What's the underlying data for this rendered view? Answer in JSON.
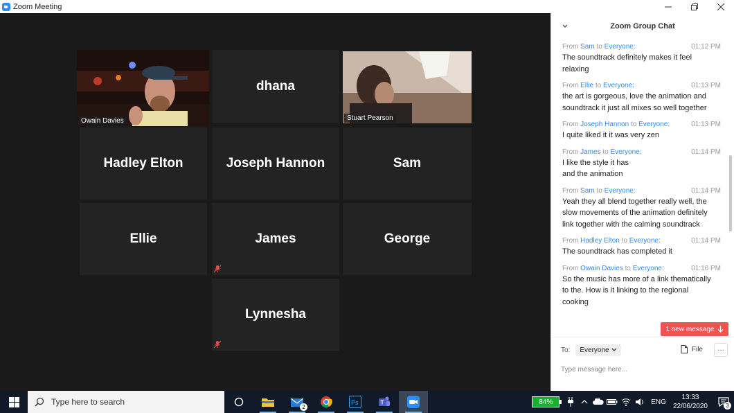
{
  "window": {
    "title": "Zoom Meeting"
  },
  "participants": [
    {
      "name": "Owain Davies",
      "video": true,
      "active": true
    },
    {
      "name": "dhana",
      "video": false
    },
    {
      "name": "Stuart Pearson",
      "video": true
    },
    {
      "name": "Hadley Elton",
      "video": false
    },
    {
      "name": "Joseph Hannon",
      "video": false
    },
    {
      "name": "Sam",
      "video": false
    },
    {
      "name": "Ellie",
      "video": false
    },
    {
      "name": "James",
      "video": false,
      "muted": true
    },
    {
      "name": "George",
      "video": false
    },
    {
      "name": "Lynnesha",
      "video": false,
      "muted": true
    }
  ],
  "chat": {
    "title": "Zoom Group Chat",
    "from_word": "From",
    "to_word": "to",
    "messages": [
      {
        "sender": "Sam",
        "recipient": "Everyone:",
        "time": "01:12 PM",
        "text": "The soundtrack definitely makes it feel relaxing"
      },
      {
        "sender": "Ellie",
        "recipient": "Everyone:",
        "time": "01:13 PM",
        "text": "the art is gorgeous, love the animation and soundtrack it just all mixes so well together"
      },
      {
        "sender": "Joseph Hannon",
        "recipient": "Everyone:",
        "time": "01:13 PM",
        "text": "I quite liked it it was very zen"
      },
      {
        "sender": "James",
        "recipient": "Everyone:",
        "time": "01:14 PM",
        "text": "I like the style it has\nand the animation"
      },
      {
        "sender": "Sam",
        "recipient": "Everyone:",
        "time": "01:14 PM",
        "text": "Yeah they all blend together really well, the slow movements of the animation definitely link together with the calming soundtrack"
      },
      {
        "sender": "Hadley Elton",
        "recipient": "Everyone:",
        "time": "01:14 PM",
        "text": "The soundtrack has completed it"
      },
      {
        "sender": "Owain Davies",
        "recipient": "Everyone:",
        "time": "01:16 PM",
        "text": "So the music has more of a link thematically to the. How is it linking to the regional cooking"
      }
    ],
    "new_message_label": "1 new message",
    "to_label": "To:",
    "to_value": "Everyone",
    "file_label": "File",
    "more_label": "···",
    "input_placeholder": "Type message here..."
  },
  "taskbar": {
    "search_placeholder": "Type here to search",
    "mail_badge": "2",
    "battery_percent": "84%",
    "language": "ENG",
    "time": "13:33",
    "date": "22/06/2020",
    "notification_count": "3"
  },
  "colors": {
    "active_speaker": "#e5f22e",
    "chat_link": "#2d8cff",
    "new_message_bg": "#ef5350",
    "taskbar_bg": "#101a28"
  }
}
